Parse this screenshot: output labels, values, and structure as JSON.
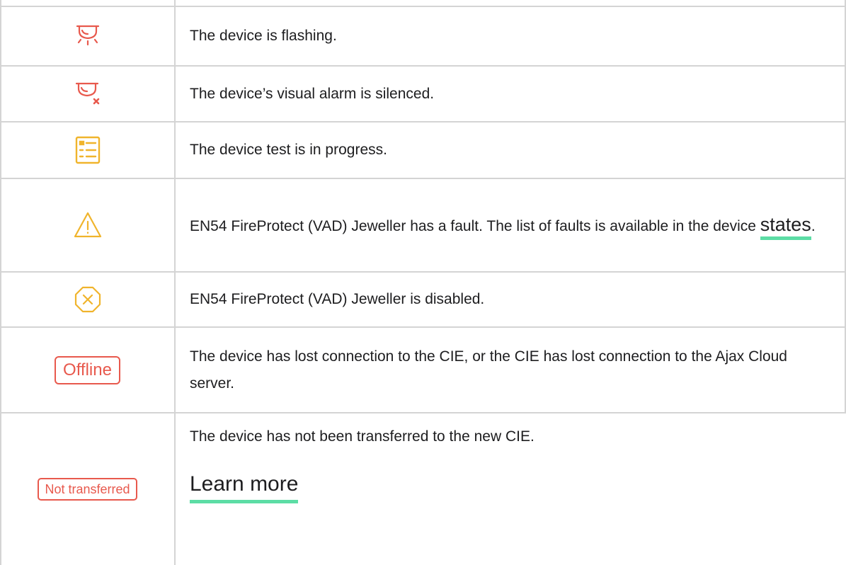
{
  "colors": {
    "alert_red": "#e8594d",
    "warning_yellow": "#f0b42c",
    "link_underline": "#5cdda5",
    "grid_line": "#d4d4d4"
  },
  "rows": [
    {
      "icon": "siren-flashing-icon",
      "text": "The device is flashing."
    },
    {
      "icon": "siren-silenced-icon",
      "text": "The device’s visual alarm is silenced."
    },
    {
      "icon": "device-test-list-icon",
      "text": "The device test is in progress."
    },
    {
      "icon": "warning-triangle-icon",
      "text_before": "EN54 FireProtect (VAD) Jeweller has a fault. The list of faults is available in the device ",
      "link": "states",
      "text_after": "."
    },
    {
      "icon": "disabled-octagon-icon",
      "text": "EN54 FireProtect (VAD) Jeweller is disabled."
    },
    {
      "badge": "Offline",
      "text": "The device has lost connection to the CIE, or the CIE has lost connection to the Ajax Cloud server."
    },
    {
      "badge": "Not transferred",
      "text": "The device has not been transferred to the new CIE.",
      "link": "Learn more"
    }
  ]
}
